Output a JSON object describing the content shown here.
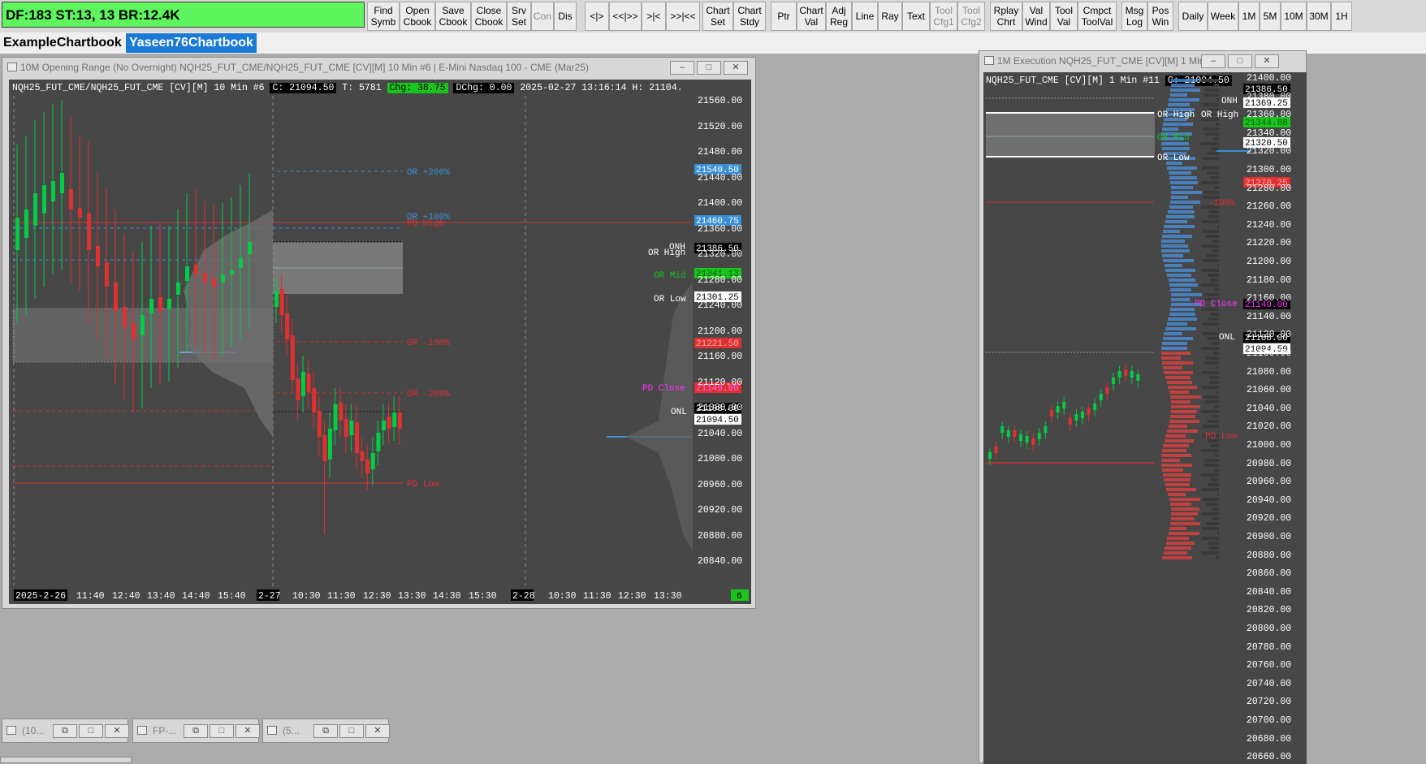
{
  "status": {
    "text": "DF:183  ST:13, 13  BR:12.4K"
  },
  "toolbar": [
    {
      "label": "Find\nSymb",
      "dis": false
    },
    {
      "label": "Open\nCbook",
      "dis": false
    },
    {
      "label": "Save\nCbook",
      "dis": false
    },
    {
      "label": "Close\nCbook",
      "dis": false
    },
    {
      "label": "Srv\nSet",
      "dis": false
    },
    {
      "label": "Con",
      "dis": true
    },
    {
      "label": "Dis",
      "dis": false
    },
    {
      "label": "<|>",
      "dis": false
    },
    {
      "label": "<<|>>",
      "dis": false
    },
    {
      "label": ">|<",
      "dis": false
    },
    {
      "label": ">>|<<",
      "dis": false
    },
    {
      "label": "Chart\nSet",
      "dis": false
    },
    {
      "label": "Chart\nStdy",
      "dis": false
    },
    {
      "label": "Ptr",
      "dis": false
    },
    {
      "label": "Chart\nVal",
      "dis": false
    },
    {
      "label": "Adj\nReg",
      "dis": false
    },
    {
      "label": "Line",
      "dis": false
    },
    {
      "label": "Ray",
      "dis": false
    },
    {
      "label": "Text",
      "dis": false
    },
    {
      "label": "Tool\nCfg1",
      "dis": true
    },
    {
      "label": "Tool\nCfg2",
      "dis": true
    },
    {
      "label": "Rplay\nChrt",
      "dis": false
    },
    {
      "label": "Val\nWind",
      "dis": false
    },
    {
      "label": "Tool\nVal",
      "dis": false
    },
    {
      "label": "Cmpct\nToolVal",
      "dis": false
    },
    {
      "label": "Msg\nLog",
      "dis": false
    },
    {
      "label": "Pos\nWin",
      "dis": false
    },
    {
      "label": "Daily",
      "dis": false
    },
    {
      "label": "Week",
      "dis": false
    },
    {
      "label": "1M",
      "dis": false
    },
    {
      "label": "5M",
      "dis": false
    },
    {
      "label": "10M",
      "dis": false
    },
    {
      "label": "30M",
      "dis": false
    },
    {
      "label": "1H",
      "dis": false
    }
  ],
  "chartbooks": {
    "tab1": "ExampleChartbook",
    "tab2": "Yaseen76Chartbook"
  },
  "colors": {
    "ma_green": "#00cc44",
    "ma_red": "#e03030",
    "or_blue": "#3a8fd6",
    "pd_magenta": "#ff00ff"
  },
  "window1": {
    "title": "10M Opening Range (No Overnight) NQH25_FUT_CME/NQH25_FUT_CME [CV][M]  10 Min  #6 | E-Mini Nasdaq 100 - CME (Mar25)",
    "header": {
      "symbol": "NQH25_FUT_CME/NQH25_FUT_CME [CV][M]   10 Min   #6",
      "c": "C: 21094.50",
      "t": "T: 5781",
      "chg": "Chg: 38.75",
      "dchg": "DChg: 0.00",
      "dt": "2025-02-27  13:16:14  H: 21104."
    },
    "prices": [
      "21560.00",
      "21520.00",
      "21480.00",
      "21440.00",
      "21400.00",
      "21360.00",
      "21320.00",
      "21280.00",
      "21240.00",
      "21200.00",
      "21160.00",
      "21120.00",
      "21080.00",
      "21040.00",
      "21000.00",
      "20960.00",
      "20920.00",
      "20880.00",
      "20840.00"
    ],
    "axis_labels": {
      "or200": "21540.50",
      "or100": "21460.75",
      "onh": "21386.50",
      "ormid": "21341.13",
      "orlow": "21301.25",
      "orm100": "21221.50",
      "pdclose": "21149.00",
      "onl": "21108.00",
      "last": "21094.50"
    },
    "annotations": {
      "or_plus200": "OR +200%",
      "or_plus100": "OR +100%",
      "pd_high": "PD High",
      "or_minus100": "OR -100%",
      "or_minus200": "OR -200%",
      "pd_low": "PD Low",
      "or_high": "OR High",
      "onh": "ONH",
      "or_mid": "OR Mid",
      "or_low": "OR Low",
      "pd_close": "PD Close",
      "onl": "ONL"
    },
    "times": [
      "2025-2-26",
      "11:40",
      "12:40",
      "13:40",
      "14:40",
      "15:40",
      "2-27",
      "10:30",
      "11:30",
      "12:30",
      "13:30",
      "14:30",
      "15:30",
      "2-28",
      "10:30",
      "11:30",
      "12:30",
      "13:30"
    ],
    "badge": "6"
  },
  "window2": {
    "title": "1M Execution NQH25_FUT_CME [CV][M]  1 Min  #...",
    "header": {
      "symbol": "NQH25_FUT_CME [CV][M]   1 Min   #11",
      "c": "C: 21094.50"
    },
    "prices": [
      "21400.00",
      "21380.00",
      "21360.00",
      "21340.00",
      "21320.00",
      "21300.00",
      "21280.00",
      "21260.00",
      "21240.00",
      "21220.00",
      "21200.00",
      "21180.00",
      "21160.00",
      "21140.00",
      "21120.00",
      "21100.00",
      "21080.00",
      "21060.00",
      "21040.00",
      "21020.00",
      "21000.00",
      "20980.00",
      "20960.00",
      "20940.00",
      "20920.00",
      "20900.00",
      "20880.00",
      "20860.00",
      "20840.00",
      "20820.00",
      "20800.00",
      "20780.00",
      "20760.00",
      "20740.00",
      "20720.00",
      "20700.00",
      "20680.00",
      "20660.00"
    ],
    "axis_labels": {
      "onh": "21386.50",
      "orhigh": "21369.25",
      "ormid": "21344.88",
      "orlow": "21320.50",
      "orm100": "21270.25",
      "pdclose": "21149.00",
      "onl": "21108.00",
      "last": "21094.50"
    },
    "annotations": {
      "or_high_a": "OR High",
      "or_high_b": "OR High",
      "onh": "ONH",
      "or_mid": "OR Mid",
      "or_low": "OR Low",
      "or_minus100": "-100%",
      "pd_close": "PD Close",
      "onl": "ONL",
      "pd_low": "PD Low"
    }
  },
  "minimized": [
    {
      "label": "(10..."
    },
    {
      "label": "FP-..."
    },
    {
      "label": "(5..."
    }
  ]
}
